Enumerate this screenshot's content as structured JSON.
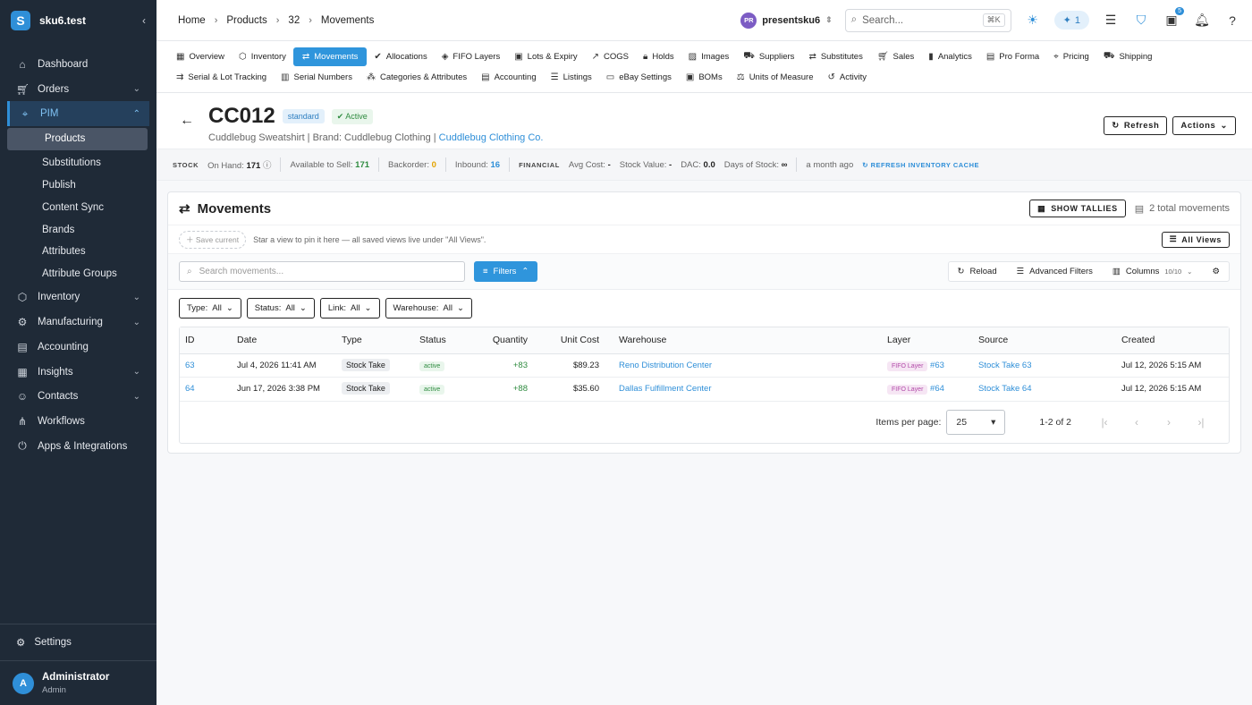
{
  "sidebar": {
    "app_name": "sku6.test",
    "logo_letter": "S",
    "collapse_icon": "chevron-left-icon",
    "items": [
      {
        "label": "Dashboard",
        "icon": "home-icon",
        "expandable": false
      },
      {
        "label": "Orders",
        "icon": "cart-icon",
        "expandable": true
      },
      {
        "label": "PIM",
        "icon": "tag-icon",
        "expandable": true,
        "active": true
      }
    ],
    "pim_children": [
      "Products",
      "Substitutions",
      "Publish",
      "Content Sync",
      "Brands",
      "Attributes",
      "Attribute Groups"
    ],
    "items_after": [
      {
        "label": "Inventory",
        "icon": "box-icon",
        "expandable": true
      },
      {
        "label": "Manufacturing",
        "icon": "factory-icon",
        "expandable": true
      },
      {
        "label": "Accounting",
        "icon": "ledger-icon",
        "expandable": false
      },
      {
        "label": "Insights",
        "icon": "chart-icon",
        "expandable": true
      },
      {
        "label": "Contacts",
        "icon": "contacts-icon",
        "expandable": true
      },
      {
        "label": "Workflows",
        "icon": "workflow-icon",
        "expandable": false
      },
      {
        "label": "Apps & Integrations",
        "icon": "plug-icon",
        "expandable": false
      }
    ],
    "settings_label": "Settings",
    "user": {
      "initial": "A",
      "name": "Administrator",
      "role": "Admin"
    }
  },
  "topbar": {
    "breadcrumbs": [
      "Home",
      "Products",
      "32",
      "Movements"
    ],
    "user_initials": "PR",
    "user_name": "presentsku6",
    "search_placeholder": "Search...",
    "search_shortcut": "⌘K",
    "ai_count": "1",
    "gift_badge": "5"
  },
  "tabs_row1": [
    {
      "label": "Overview",
      "icon": "overview-icon"
    },
    {
      "label": "Inventory",
      "icon": "box-icon"
    },
    {
      "label": "Movements",
      "icon": "swap-icon",
      "active": true
    },
    {
      "label": "Allocations",
      "icon": "check-circle-icon"
    },
    {
      "label": "FIFO Layers",
      "icon": "layers-icon"
    },
    {
      "label": "Lots & Expiry",
      "icon": "calendar-icon"
    },
    {
      "label": "COGS",
      "icon": "trend-icon"
    },
    {
      "label": "Holds",
      "icon": "lock-icon"
    },
    {
      "label": "Images",
      "icon": "image-icon"
    },
    {
      "label": "Suppliers",
      "icon": "truck-icon"
    },
    {
      "label": "Substitutes",
      "icon": "swap-icon"
    },
    {
      "label": "Sales",
      "icon": "cart-icon"
    },
    {
      "label": "Analytics",
      "icon": "bar-chart-icon"
    },
    {
      "label": "Pro Forma",
      "icon": "document-icon"
    },
    {
      "label": "Pricing",
      "icon": "price-tag-icon"
    },
    {
      "label": "Shipping",
      "icon": "shipping-icon"
    }
  ],
  "tabs_row2": [
    {
      "label": "Serial & Lot Tracking",
      "icon": "tracking-icon"
    },
    {
      "label": "Serial Numbers",
      "icon": "barcode-icon"
    },
    {
      "label": "Categories & Attributes",
      "icon": "categories-icon"
    },
    {
      "label": "Accounting",
      "icon": "ledger-icon"
    },
    {
      "label": "Listings",
      "icon": "list-icon"
    },
    {
      "label": "eBay Settings",
      "icon": "ebay-icon"
    },
    {
      "label": "BOMs",
      "icon": "bom-icon"
    },
    {
      "label": "Units of Measure",
      "icon": "scale-icon"
    },
    {
      "label": "Activity",
      "icon": "history-icon"
    }
  ],
  "product": {
    "sku": "CC012",
    "type_chip": "standard",
    "status_chip": "Active",
    "subtitle": "Cuddlebug Sweatshirt | Brand: Cuddlebug Clothing |",
    "supplier_link": "Cuddlebug Clothing Co.",
    "refresh_label": "Refresh",
    "actions_label": "Actions"
  },
  "stock": {
    "stock_caption": "STOCK",
    "on_hand_label": "On Hand:",
    "on_hand": "171",
    "available_label": "Available to Sell:",
    "available": "171",
    "backorder_label": "Backorder:",
    "backorder": "0",
    "inbound_label": "Inbound:",
    "inbound": "16",
    "financial_caption": "FINANCIAL",
    "avg_cost_label": "Avg Cost:",
    "avg_cost": "-",
    "stock_value_label": "Stock Value:",
    "stock_value": "-",
    "dac_label": "DAC:",
    "dac": "0.0",
    "days_label": "Days of Stock:",
    "days": "∞",
    "updated": "a month ago",
    "refresh_cache": "REFRESH INVENTORY CACHE"
  },
  "movements": {
    "title": "Movements",
    "tallies_label": "SHOW TALLIES",
    "total": "2 total movements",
    "save_current": "Save current",
    "views_hint": "Star a view to pin it here — all saved views live under \"All Views\".",
    "all_views": "All Views",
    "search_placeholder": "Search movements...",
    "filters_label": "Filters",
    "reload_label": "Reload",
    "advanced_label": "Advanced Filters",
    "columns_label": "Columns",
    "columns_count": "10/10",
    "filter_chips": [
      {
        "key": "Type:",
        "value": "All"
      },
      {
        "key": "Status:",
        "value": "All"
      },
      {
        "key": "Link:",
        "value": "All"
      },
      {
        "key": "Warehouse:",
        "value": "All"
      }
    ],
    "columns": [
      "ID",
      "Date",
      "Type",
      "Status",
      "Quantity",
      "Unit Cost",
      "Warehouse",
      "Layer",
      "Source",
      "Created"
    ],
    "rows": [
      {
        "id": "63",
        "date": "Jul 4, 2026 11:41 AM",
        "type": "Stock Take",
        "status": "active",
        "quantity": "+83",
        "unit_cost": "$89.23",
        "warehouse": "Reno Distribution Center",
        "layer_chip": "FIFO Layer",
        "layer_ref": "#63",
        "source": "Stock Take 63",
        "created": "Jul 12, 2026 5:15 AM"
      },
      {
        "id": "64",
        "date": "Jun 17, 2026 3:38 PM",
        "type": "Stock Take",
        "status": "active",
        "quantity": "+88",
        "unit_cost": "$35.60",
        "warehouse": "Dallas Fulfillment Center",
        "layer_chip": "FIFO Layer",
        "layer_ref": "#64",
        "source": "Stock Take 64",
        "created": "Jul 12, 2026 5:15 AM"
      }
    ],
    "pager": {
      "items_per_page_label": "Items per page:",
      "items_per_page": "25",
      "range": "1-2 of 2"
    }
  }
}
